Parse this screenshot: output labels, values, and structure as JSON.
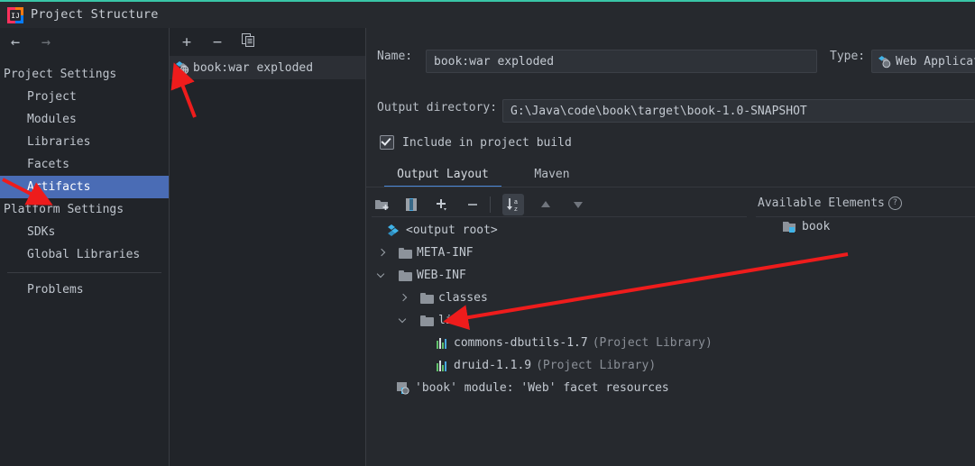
{
  "window": {
    "title": "Project Structure",
    "app_icon": "intellij-idea-icon",
    "accent_color": "#39c6a7"
  },
  "nav": {
    "back_icon": "arrow-left-icon",
    "forward_icon": "arrow-right-icon"
  },
  "sidebar": {
    "groups": [
      {
        "label": "Project Settings",
        "items": [
          {
            "label": "Project",
            "selected": false
          },
          {
            "label": "Modules",
            "selected": false
          },
          {
            "label": "Libraries",
            "selected": false
          },
          {
            "label": "Facets",
            "selected": false
          },
          {
            "label": "Artifacts",
            "selected": true
          }
        ]
      },
      {
        "label": "Platform Settings",
        "items": [
          {
            "label": "SDKs",
            "selected": false
          },
          {
            "label": "Global Libraries",
            "selected": false
          }
        ]
      }
    ],
    "footer_items": [
      {
        "label": "Problems",
        "selected": false
      }
    ],
    "selection_color": "#4a6cb5"
  },
  "artifact_list": {
    "toolbar": [
      {
        "name": "add-artifact-button",
        "icon": "plus-icon",
        "glyph": "+"
      },
      {
        "name": "remove-artifact-button",
        "icon": "minus-icon",
        "glyph": "−"
      },
      {
        "name": "copy-artifact-button",
        "icon": "copy-icon",
        "glyph": "❐"
      }
    ],
    "items": [
      {
        "label": "book:war exploded",
        "icon": "artifact-icon",
        "selected": true
      }
    ]
  },
  "details": {
    "name_label": "Name:",
    "name_value": "book:war exploded",
    "type_label": "Type:",
    "type_value": "Web Applicat",
    "type_icon": "web-application-icon",
    "output_dir_label": "Output directory:",
    "output_dir_value": "G:\\Java\\code\\book\\target\\book-1.0-SNAPSHOT",
    "include_in_build_label": "Include in project build",
    "include_in_build_checked": true
  },
  "tabs": [
    {
      "label": "Output Layout",
      "active": true
    },
    {
      "label": "Maven",
      "active": false
    }
  ],
  "layout_toolbar": {
    "buttons": [
      {
        "name": "create-directory-button",
        "icon": "new-folder-icon",
        "active": false
      },
      {
        "name": "create-archive-button",
        "icon": "archive-icon",
        "active": false
      },
      {
        "name": "add-copy-button",
        "icon": "plus-dropdown-icon",
        "active": false
      },
      {
        "name": "remove-element-button",
        "icon": "minus-icon",
        "active": false
      },
      {
        "name": "sort-button",
        "icon": "sort-az-icon",
        "active": true
      },
      {
        "name": "move-up-button",
        "icon": "arrow-up-icon",
        "active": false
      },
      {
        "name": "move-down-button",
        "icon": "arrow-down-icon",
        "active": false
      }
    ],
    "available_elements_label": "Available Elements",
    "help_icon": "question-mark-icon"
  },
  "output_tree": [
    {
      "depth": 0,
      "twisty": "none",
      "icon": "output-root-icon",
      "label": "<output root>",
      "suffix": ""
    },
    {
      "depth": 0,
      "twisty": "collapsed",
      "icon": "folder-icon",
      "label": "META-INF",
      "suffix": ""
    },
    {
      "depth": 0,
      "twisty": "expanded",
      "icon": "folder-icon",
      "label": "WEB-INF",
      "suffix": ""
    },
    {
      "depth": 1,
      "twisty": "collapsed",
      "icon": "folder-icon",
      "label": "classes",
      "suffix": ""
    },
    {
      "depth": 1,
      "twisty": "expanded",
      "icon": "folder-icon",
      "label": "lib",
      "suffix": ""
    },
    {
      "depth": 2,
      "twisty": "none",
      "icon": "library-icon",
      "label": "commons-dbutils-1.7",
      "suffix": "(Project Library)"
    },
    {
      "depth": 2,
      "twisty": "none",
      "icon": "library-icon",
      "label": "druid-1.1.9",
      "suffix": "(Project Library)"
    },
    {
      "depth": 0,
      "twisty": "none",
      "icon": "web-facet-icon",
      "label": "'book' module: 'Web' facet resources",
      "suffix": ""
    }
  ],
  "available_elements": [
    {
      "label": "book",
      "icon": "module-folder-icon"
    }
  ],
  "annotations": {
    "color": "#ee1c1c",
    "arrows": [
      {
        "name": "arrow-to-artifact-item"
      },
      {
        "name": "arrow-to-artifacts-nav"
      },
      {
        "name": "arrow-from-book-to-lib"
      }
    ]
  }
}
